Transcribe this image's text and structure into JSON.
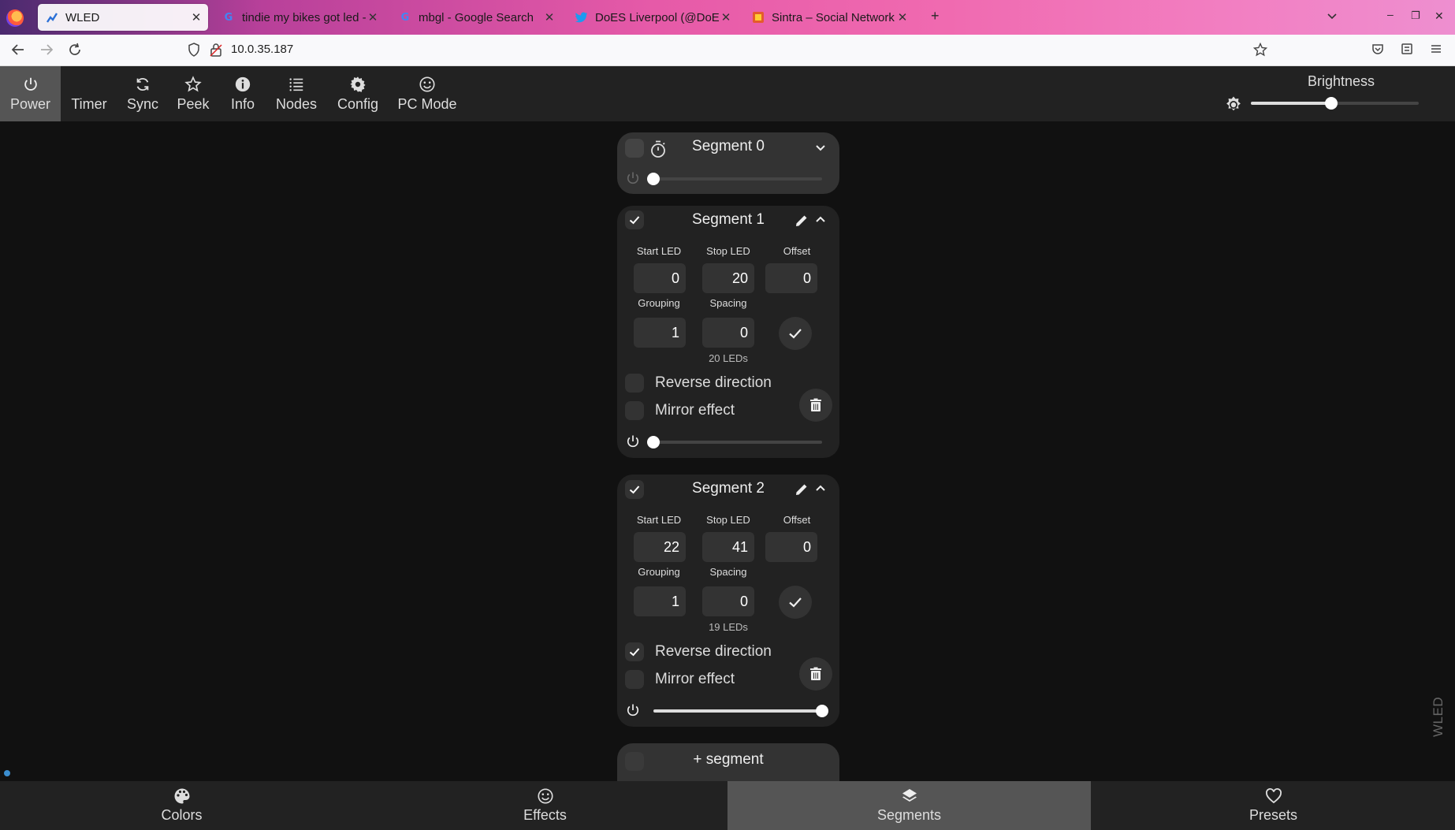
{
  "browser": {
    "tabs": [
      {
        "title": "WLED",
        "icon": "wled-icon"
      },
      {
        "title": "tindie my bikes got led - Goo",
        "icon": "google-icon"
      },
      {
        "title": "mbgl - Google Search",
        "icon": "google-icon"
      },
      {
        "title": "DoES Liverpool (@DoESLiv",
        "icon": "twitter-icon"
      },
      {
        "title": "Sintra – Social Network fo",
        "icon": "sintra-icon"
      }
    ],
    "url": "10.0.35.187"
  },
  "topbar": {
    "buttons": [
      {
        "label": "Power",
        "icon": "power-icon",
        "active": true
      },
      {
        "label": "Timer",
        "icon": "moon-icon",
        "active": false
      },
      {
        "label": "Sync",
        "icon": "sync-icon",
        "active": false
      },
      {
        "label": "Peek",
        "icon": "star-icon",
        "active": false
      },
      {
        "label": "Info",
        "icon": "info-icon",
        "active": false
      },
      {
        "label": "Nodes",
        "icon": "list-icon",
        "active": false
      },
      {
        "label": "Config",
        "icon": "gear-icon",
        "active": false
      },
      {
        "label": "PC Mode",
        "icon": "smiley-icon",
        "active": false
      }
    ],
    "brightness_label": "Brightness",
    "brightness_level": 0.48
  },
  "segments": [
    {
      "title": "Segment 0",
      "selected": false,
      "expanded": false,
      "level": 0.0
    },
    {
      "title": "Segment 1",
      "selected": true,
      "expanded": true,
      "start_label": "Start LED",
      "stop_label": "Stop LED",
      "offset_label": "Offset",
      "grouping_label": "Grouping",
      "spacing_label": "Spacing",
      "start": "0",
      "stop": "20",
      "offset": "0",
      "grouping": "1",
      "spacing": "0",
      "led_count": "20 LEDs",
      "reverse_label": "Reverse direction",
      "reverse": false,
      "mirror_label": "Mirror effect",
      "mirror": false,
      "level": 0.0
    },
    {
      "title": "Segment 2",
      "selected": true,
      "expanded": true,
      "start_label": "Start LED",
      "stop_label": "Stop LED",
      "offset_label": "Offset",
      "grouping_label": "Grouping",
      "spacing_label": "Spacing",
      "start": "22",
      "stop": "41",
      "offset": "0",
      "grouping": "1",
      "spacing": "0",
      "led_count": "19 LEDs",
      "reverse_label": "Reverse direction",
      "reverse": true,
      "mirror_label": "Mirror effect",
      "mirror": false,
      "level": 1.0
    }
  ],
  "add_segment_label": "segment",
  "bottombar": {
    "tabs": [
      {
        "label": "Colors",
        "icon": "palette-icon",
        "active": false
      },
      {
        "label": "Effects",
        "icon": "smiley-icon",
        "active": false
      },
      {
        "label": "Segments",
        "icon": "layers-icon",
        "active": true
      },
      {
        "label": "Presets",
        "icon": "heart-icon",
        "active": false
      }
    ]
  },
  "watermark": "WLED",
  "colors": {
    "accent": "#3b8ed0",
    "panel": "#222222",
    "active": "#555555"
  }
}
